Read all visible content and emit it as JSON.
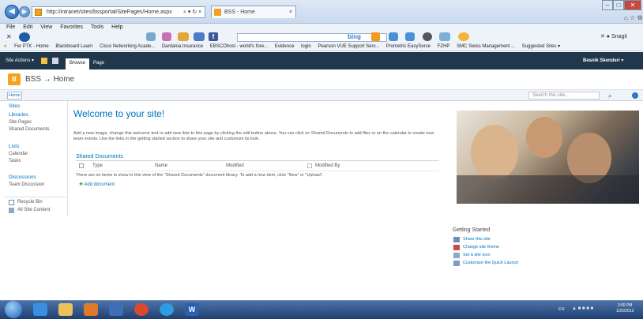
{
  "browser": {
    "address": "http://intranet/sites/bssportal/SitePages/Home.aspx",
    "addr_controls": "⌕ ▾ ↻ ×",
    "tab_title": "BSS - Home",
    "tab_close": "×",
    "menu": [
      "File",
      "Edit",
      "View",
      "Favorites",
      "Tools",
      "Help"
    ],
    "toolbar_search_brand": "bing",
    "extra_right": "Snagit",
    "favorites": [
      "Fer PTK - Home",
      "Blackboard Learn",
      "Cisco Networking Acade...",
      "Dardania Insurance",
      "EBSCOhost - world's fore...",
      "Evidence",
      "login",
      "Pearson VUE Support Serv...",
      "Prometric EasyServe",
      "FZHP",
      "SMC Swiss Management ...",
      "Suggested Sites ▾"
    ]
  },
  "ribbon": {
    "site_actions": "Site Actions ▾",
    "tab_browse": "Browse",
    "tab_page": "Page",
    "user": "Besnik Skenderi ▾"
  },
  "header": {
    "logo_letter": "B",
    "breadcrumb": "BSS → Home"
  },
  "topnav": {
    "home": "Home",
    "search_placeholder": "Search this site...",
    "search_icon": "⌕"
  },
  "quicklaunch": {
    "sites": "Sites",
    "libraries": "Libraries",
    "site_pages": "Site Pages",
    "shared_documents": "Shared Documents",
    "lists": "Lists",
    "calendar": "Calendar",
    "tasks": "Tasks",
    "discussions": "Discussions",
    "team_discussion": "Team Discussion",
    "recycle_bin": "Recycle Bin",
    "all_site_content": "All Site Content"
  },
  "main": {
    "welcome": "Welcome to your site!",
    "intro": "Add a new image, change this welcome text or add new lists to this page by clicking the edit button above. You can click on Shared Documents to add files or on the calendar to create new team events. Use the links in the getting started section to share your site and customize its look.",
    "shared_title": "Shared Documents",
    "columns": [
      "Type",
      "Name",
      "Modified",
      "Modified By"
    ],
    "empty_message": "There are no items to show in this view of the \"Shared Documents\" document library. To add a new item, click \"New\" or \"Upload\".",
    "add_document": "Add document"
  },
  "getting_started": {
    "title": "Getting Started",
    "items": [
      "Share this site",
      "Change site theme",
      "Set a site icon",
      "Customize the Quick Launch"
    ]
  },
  "taskbar": {
    "lang": "EN",
    "time": "3:55 PM",
    "date": "1/26/2013"
  },
  "colors": {
    "ribbon_dark": "#21374c",
    "link_blue": "#0072bc",
    "accent_orange": "#f5a419"
  }
}
